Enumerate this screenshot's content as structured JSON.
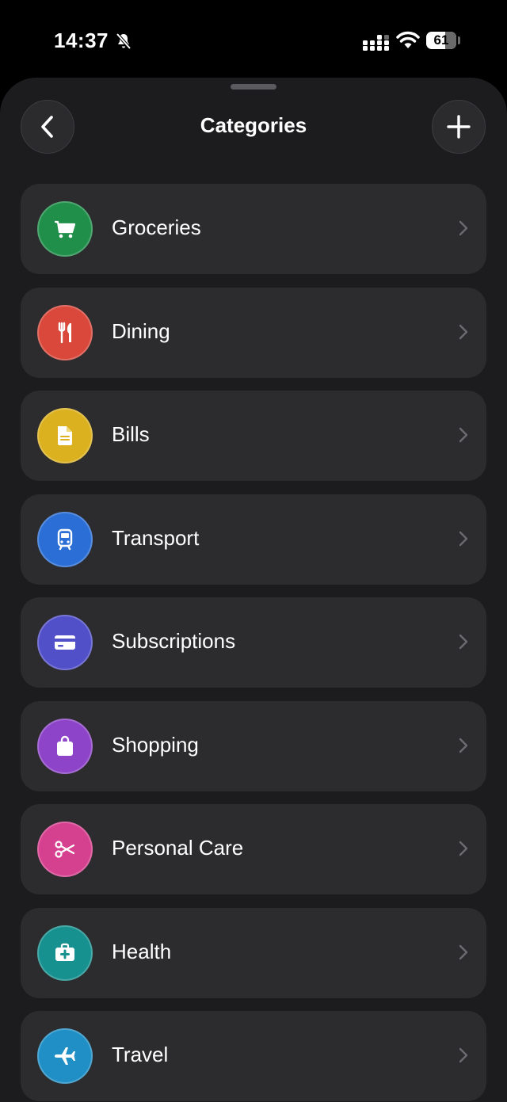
{
  "status_bar": {
    "time": "14:37",
    "battery": "61",
    "icons": [
      "bell-slash-icon",
      "cellular-signal-icon",
      "wifi-icon",
      "battery-icon"
    ]
  },
  "header": {
    "title": "Categories",
    "back_icon": "chevron-left-icon",
    "add_icon": "plus-icon"
  },
  "categories": [
    {
      "label": "Groceries",
      "icon": "cart-icon",
      "color": "#1f8f4a"
    },
    {
      "label": "Dining",
      "icon": "fork-knife-icon",
      "color": "#d9483b"
    },
    {
      "label": "Bills",
      "icon": "document-icon",
      "color": "#dbb120"
    },
    {
      "label": "Transport",
      "icon": "tram-icon",
      "color": "#2b6fd6"
    },
    {
      "label": "Subscriptions",
      "icon": "credit-card-icon",
      "color": "#5250c9"
    },
    {
      "label": "Shopping",
      "icon": "shopping-bag-icon",
      "color": "#8e44c8"
    },
    {
      "label": "Personal Care",
      "icon": "scissors-icon",
      "color": "#d6418f"
    },
    {
      "label": "Health",
      "icon": "medical-kit-icon",
      "color": "#17918f"
    },
    {
      "label": "Travel",
      "icon": "airplane-icon",
      "color": "#1f8fc6"
    }
  ]
}
